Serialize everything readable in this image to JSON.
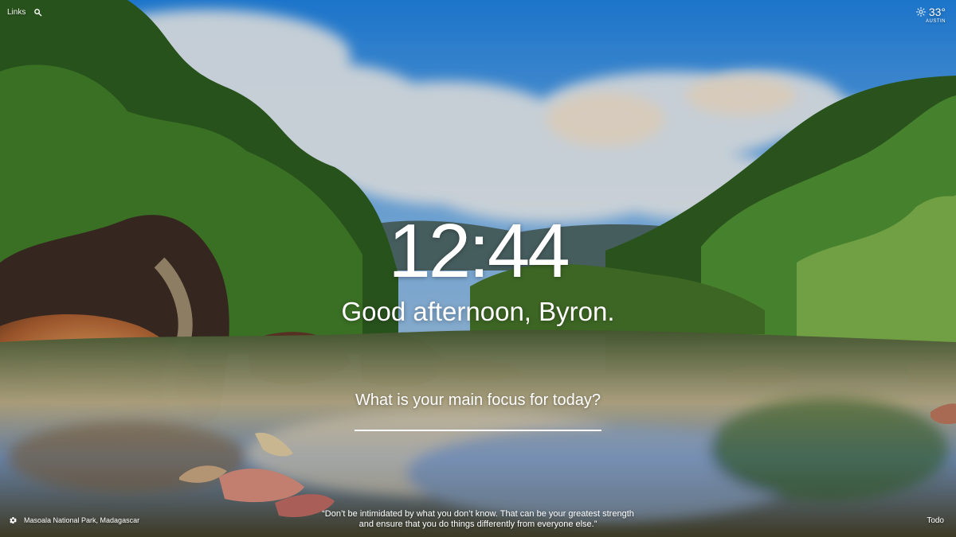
{
  "top_nav": {
    "links_label": "Links",
    "search_icon": "search-icon"
  },
  "weather": {
    "icon": "sun-icon",
    "temperature": "33°",
    "location": "AUSTIN"
  },
  "main": {
    "time": "12:44",
    "greeting": "Good afternoon, Byron.",
    "focus_question": "What is your main focus for today?",
    "focus_value": ""
  },
  "background": {
    "location": "Masoala National Park, Madagascar",
    "settings_icon": "gear-icon"
  },
  "quote": {
    "line_1": "“Don’t be intimidated by what you don’t know. That can be your greatest strength",
    "line_2": "and ensure that you do things differently from everyone else.”"
  },
  "footer": {
    "todo_label": "Todo"
  }
}
